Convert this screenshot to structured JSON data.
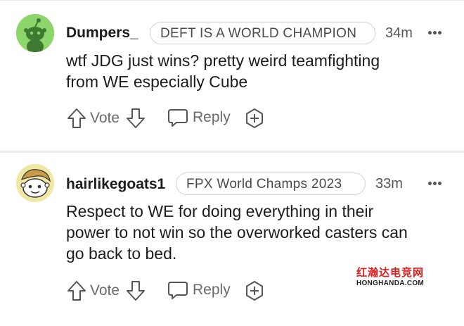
{
  "comments": [
    {
      "username": "Dumpers_",
      "flair": "DEFT IS A WORLD CHAMPION",
      "timestamp": "34m",
      "body": "wtf JDG just wins? pretty weird teamfighting\nfrom WE especially Cube",
      "vote_label": "Vote",
      "reply_label": "Reply",
      "avatar_color": "#8cd66b"
    },
    {
      "username": "hairlikegoats1",
      "flair": "FPX World Champs 2023",
      "timestamp": "33m",
      "body": "Respect to WE for doing everything in their\npower to not win so the overworked casters can\ngo back to bed.",
      "vote_label": "Vote",
      "reply_label": "Reply",
      "avatar_color": "#f1e7a5"
    }
  ],
  "icons": {
    "upvote": "arrow-up-icon",
    "downvote": "arrow-down-icon",
    "reply": "speech-bubble-icon",
    "award": "award-plus-icon",
    "more": "more-dots-icon"
  },
  "watermark": {
    "line1": "红瀚达电竞网",
    "line2": "HONGHANDA.COM"
  },
  "colors": {
    "text": "#1c1c1c",
    "muted": "#6a6a6a",
    "flair_border": "#d4d4d4",
    "watermark_red": "#d81e1e"
  }
}
